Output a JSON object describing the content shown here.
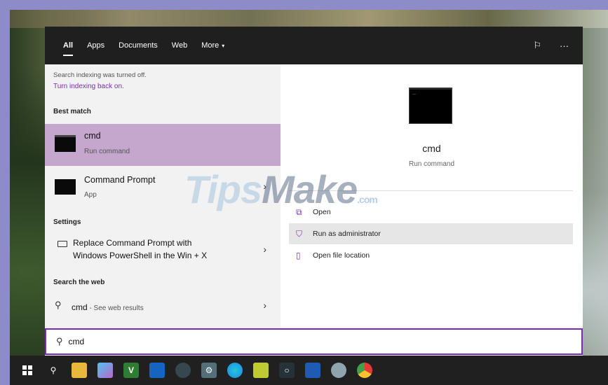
{
  "tabs": [
    "All",
    "Apps",
    "Documents",
    "Web",
    "More"
  ],
  "more_caret": "▾",
  "top_icons": {
    "feedback": "⚐",
    "more": "···"
  },
  "notice": {
    "text": "Search indexing was turned off.",
    "link": "Turn indexing back on."
  },
  "sections": {
    "best_match": "Best match",
    "settings": "Settings",
    "search_web": "Search the web"
  },
  "best_match": {
    "title": "cmd",
    "subtitle": "Run command"
  },
  "apps": [
    {
      "title": "Command Prompt",
      "subtitle": "App",
      "chevron": "›"
    }
  ],
  "settings_item": {
    "line1": "Replace Command Prompt with",
    "line2": "Windows PowerShell in the Win + X",
    "chevron": "›"
  },
  "web_result": {
    "title": "cmd",
    "subtitle": " - See web results",
    "chevron": "›"
  },
  "preview": {
    "title": "cmd",
    "subtitle": "Run command"
  },
  "actions": [
    {
      "label": "Open",
      "icon": "open-icon"
    },
    {
      "label": "Run as administrator",
      "icon": "shield-icon"
    },
    {
      "label": "Open file location",
      "icon": "file-location-icon"
    }
  ],
  "watermark": {
    "tips": "Tips",
    "make": "Make",
    "com": ".com"
  },
  "search": {
    "value": "cmd"
  },
  "colors": {
    "accent": "#7a2cb0",
    "highlight": "#c5a6cd",
    "topbar": "#1f1f1f",
    "taskbar": "#202020"
  },
  "taskbar_icons": [
    "windows-logo-icon",
    "search-icon",
    "file-explorer-icon",
    "paint-icon",
    "vim-icon",
    "vscode-icon",
    "steam-icon",
    "settings-icon",
    "edge-icon",
    "notepad-icon",
    "photoshop-icon",
    "word-icon",
    "cloud-icon",
    "chrome-icon"
  ]
}
